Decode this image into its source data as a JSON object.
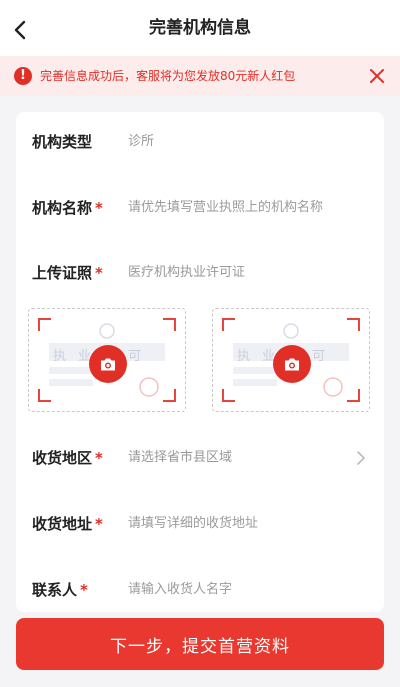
{
  "header": {
    "title": "完善机构信息"
  },
  "notice": {
    "text": "完善信息成功后，客服将为您发放80元新人红包",
    "icon": "alert-icon",
    "icon_glyph": "!",
    "color": "#e02f27"
  },
  "form": {
    "org_type": {
      "label": "机构类型",
      "value": "诊所"
    },
    "org_name": {
      "label": "机构名称",
      "required": "*",
      "placeholder": "请优先填写营业执照上的机构名称"
    },
    "license": {
      "label": "上传证照",
      "required": "*",
      "hint": "医疗机构执业许可证"
    },
    "region": {
      "label": "收货地区",
      "required": "*",
      "placeholder": "请选择省市县区域"
    },
    "address": {
      "label": "收货地址",
      "required": "*",
      "placeholder": "请填写详细的收货地址"
    },
    "contact": {
      "label": "联系人",
      "required": "*",
      "placeholder": "请输入收货人名字"
    }
  },
  "upload_placeholder": {
    "watermark": "执业许可"
  },
  "submit": {
    "label": "下一步，提交首营资料"
  },
  "colors": {
    "accent": "#e02f27",
    "button": "#e8382f",
    "notice_bg": "#fdecec"
  }
}
